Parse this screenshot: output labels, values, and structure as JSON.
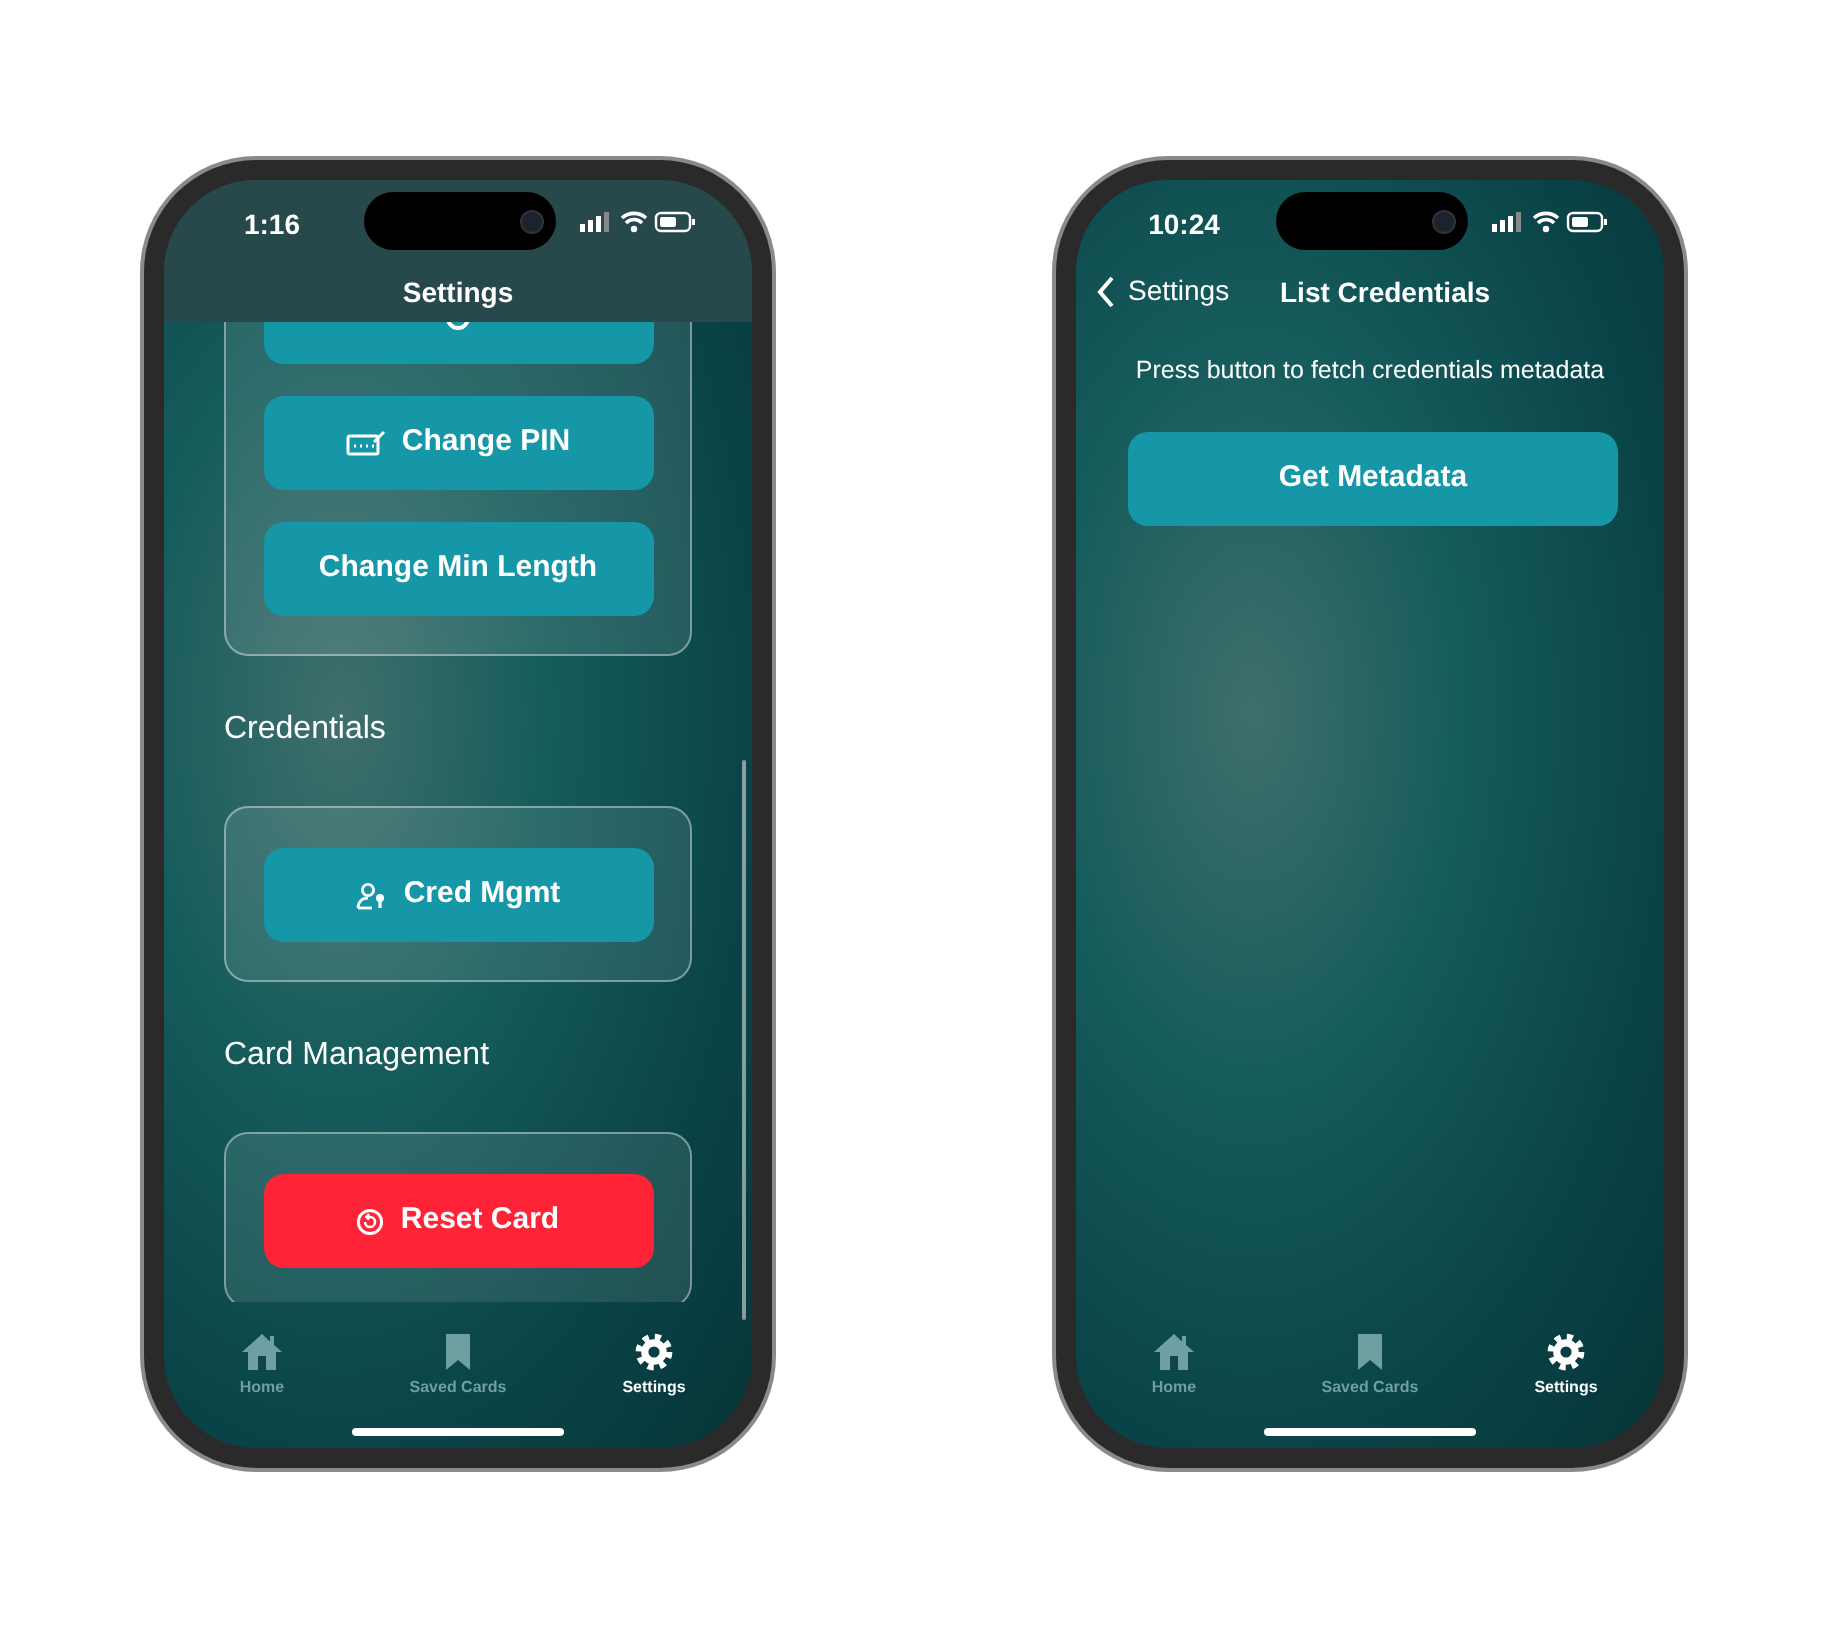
{
  "phones": [
    {
      "kind": "settings",
      "status_bar": {
        "time": "1:16"
      },
      "nav": {
        "title": "Settings"
      },
      "sections": [
        {
          "buttons": [
            {
              "kind": "primary"
            },
            {
              "kind": "primary",
              "label": "Change PIN"
            },
            {
              "kind": "primary",
              "label": "Change Min Length"
            }
          ]
        },
        {
          "heading": "Credentials",
          "buttons": [
            {
              "kind": "primary",
              "label": "Cred Mgmt"
            }
          ]
        },
        {
          "heading": "Card Management",
          "buttons": [
            {
              "kind": "danger",
              "label": "Reset Card"
            }
          ]
        }
      ],
      "tabs": [
        {
          "label": "Home",
          "selected": false
        },
        {
          "label": "Saved Cards",
          "selected": false
        },
        {
          "label": "Settings",
          "selected": true
        }
      ]
    },
    {
      "kind": "detail",
      "status_bar": {
        "time": "10:24"
      },
      "nav": {
        "back": "Settings",
        "title": "List Credentials"
      },
      "message": "Press button to fetch credentials metadata",
      "button": {
        "kind": "primary",
        "label": "Get Metadata"
      },
      "tabs": [
        {
          "label": "Home",
          "selected": false
        },
        {
          "label": "Saved Cards",
          "selected": false
        },
        {
          "label": "Settings",
          "selected": true
        }
      ]
    }
  ]
}
